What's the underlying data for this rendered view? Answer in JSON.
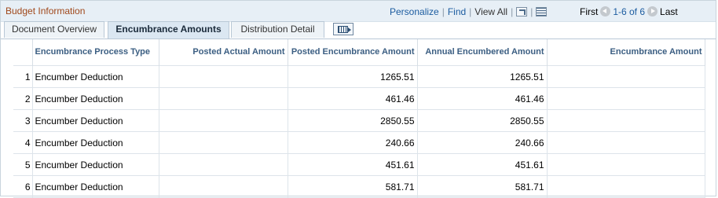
{
  "panel": {
    "title": "Budget Information"
  },
  "nav": {
    "personalize": "Personalize",
    "find": "Find",
    "view_all": "View All"
  },
  "pager": {
    "first": "First",
    "range": "1-6 of 6",
    "last": "Last"
  },
  "tabs": [
    {
      "label": "Document Overview",
      "active": false
    },
    {
      "label": "Encumbrance Amounts",
      "active": true
    },
    {
      "label": "Distribution Detail",
      "active": false
    }
  ],
  "grid": {
    "columns": [
      "Encumbrance Process Type",
      "Posted Actual Amount",
      "Posted Encumbrance Amount",
      "Annual Encumbered Amount",
      "Encumbrance Amount"
    ],
    "rows": [
      {
        "num": "1",
        "type": "Encumber Deduction",
        "posted_actual": "",
        "posted_encumbrance": "1265.51",
        "annual_encumbered": "1265.51",
        "encumbrance": ""
      },
      {
        "num": "2",
        "type": "Encumber Deduction",
        "posted_actual": "",
        "posted_encumbrance": "461.46",
        "annual_encumbered": "461.46",
        "encumbrance": ""
      },
      {
        "num": "3",
        "type": "Encumber Deduction",
        "posted_actual": "",
        "posted_encumbrance": "2850.55",
        "annual_encumbered": "2850.55",
        "encumbrance": ""
      },
      {
        "num": "4",
        "type": "Encumber Deduction",
        "posted_actual": "",
        "posted_encumbrance": "240.66",
        "annual_encumbered": "240.66",
        "encumbrance": ""
      },
      {
        "num": "5",
        "type": "Encumber Deduction",
        "posted_actual": "",
        "posted_encumbrance": "451.61",
        "annual_encumbered": "451.61",
        "encumbrance": ""
      },
      {
        "num": "6",
        "type": "Encumber Deduction",
        "posted_actual": "",
        "posted_encumbrance": "581.71",
        "annual_encumbered": "581.71",
        "encumbrance": ""
      }
    ]
  },
  "colors": {
    "title": "#a0481b",
    "link": "#1c5ca0",
    "header_text": "#3b5e82",
    "title_bar_bg": "#e7eff6"
  },
  "icons": {
    "new_window": "new-window-icon",
    "download": "grid-download-icon",
    "show_all_columns": "show-all-columns-icon"
  }
}
